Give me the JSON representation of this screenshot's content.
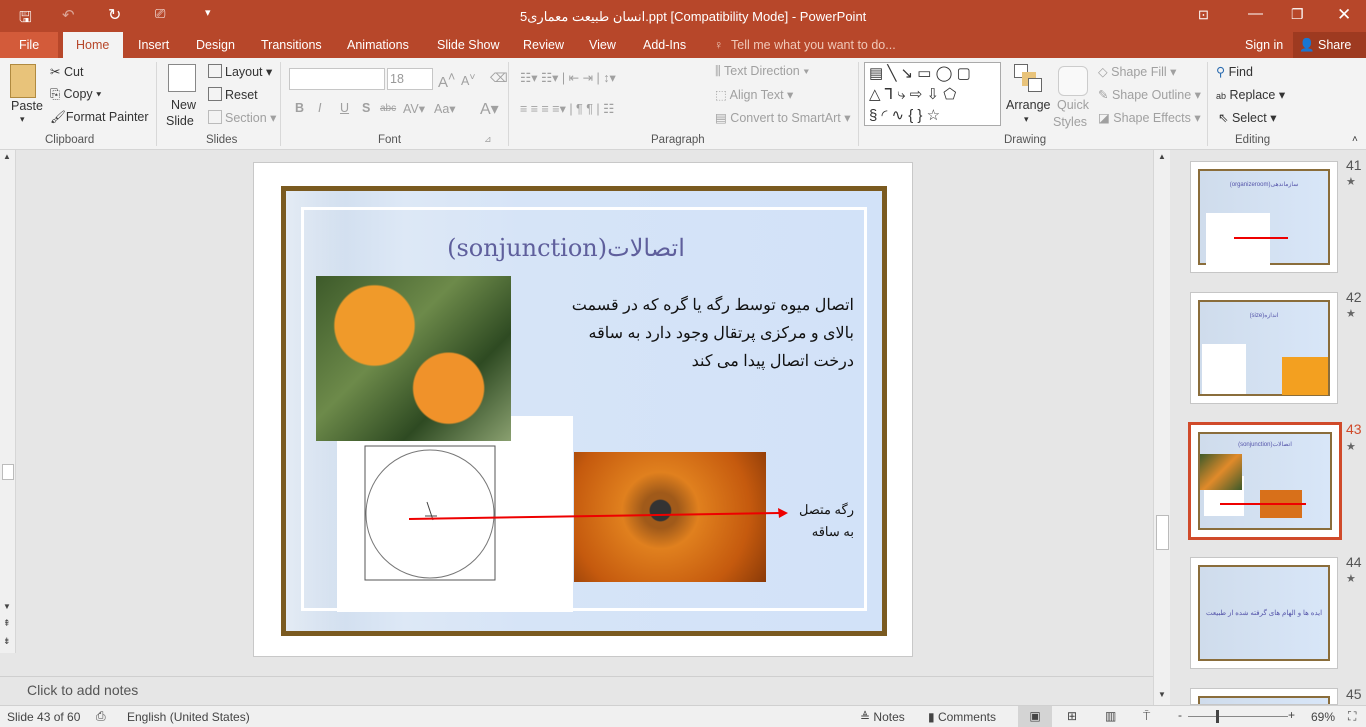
{
  "title_bar": {
    "title": "انسان طبیعت معماری5.ppt [Compatibility Mode] - PowerPoint"
  },
  "tabs": [
    "File",
    "Home",
    "Insert",
    "Design",
    "Transitions",
    "Animations",
    "Slide Show",
    "Review",
    "View",
    "Add-Ins"
  ],
  "tell_me": "Tell me what you want to do...",
  "sign_in": "Sign in",
  "share": "Share",
  "ribbon": {
    "clipboard": {
      "paste": "Paste",
      "cut": "Cut",
      "copy": "Copy",
      "format_painter": "Format Painter",
      "label": "Clipboard"
    },
    "slides": {
      "new_slide": "New",
      "new_slide2": "Slide",
      "layout": "Layout",
      "reset": "Reset",
      "section": "Section",
      "label": "Slides"
    },
    "font": {
      "font_name": "",
      "font_size": "18",
      "label": "Font"
    },
    "paragraph": {
      "text_direction": "Text Direction",
      "align_text": "Align Text",
      "convert": "Convert to SmartArt",
      "label": "Paragraph"
    },
    "drawing": {
      "arrange": "Arrange",
      "quick": "Quick",
      "styles": "Styles",
      "shape_fill": "Shape Fill",
      "shape_outline": "Shape Outline",
      "shape_effects": "Shape Effects",
      "label": "Drawing"
    },
    "editing": {
      "find": "Find",
      "replace": "Replace",
      "select": "Select",
      "label": "Editing"
    }
  },
  "slide": {
    "title": "(sonjunction)اتصالات",
    "body": "اتصال میوه توسط رگه یا گره که در قسمت بالای و مرکزی پرتقال وجود دارد به ساقه درخت اتصال پیدا می کند",
    "label1": "رگه متصل",
    "label2": "به ساقه"
  },
  "thumbnails": [
    {
      "num": "41",
      "title": "(organizeroom)سازماندهی"
    },
    {
      "num": "42",
      "title": "(size)اندازه"
    },
    {
      "num": "43",
      "title": "(sonjunction)اتصالات"
    },
    {
      "num": "44",
      "title": "ایده ها و الهام های گرفته شده از طبیعت"
    },
    {
      "num": "45",
      "title": ""
    }
  ],
  "notes_placeholder": "Click to add notes",
  "status": {
    "slide": "Slide 43 of 60",
    "language": "English (United States)",
    "notes": "Notes",
    "comments": "Comments",
    "zoom": "69%"
  },
  "colors": {
    "accent": "#b7472a",
    "selected_thumb": "#d04a2a"
  }
}
